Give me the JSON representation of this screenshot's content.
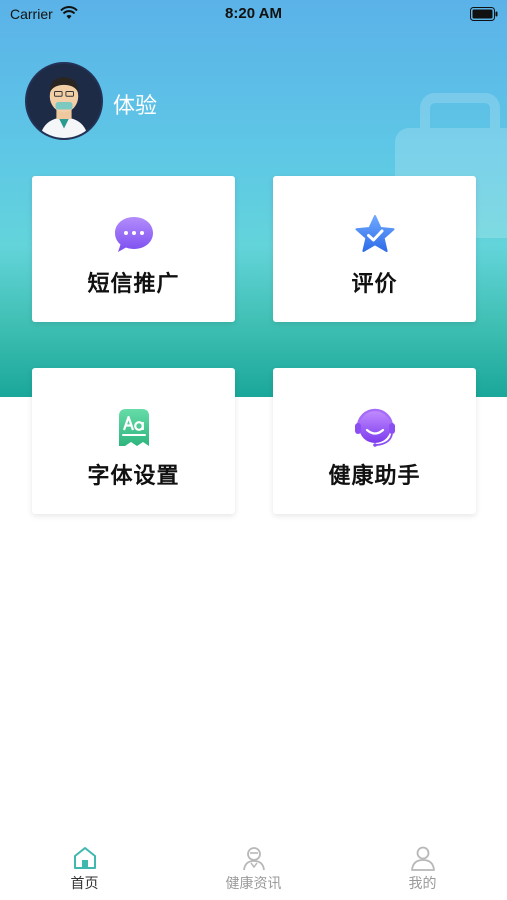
{
  "status_bar": {
    "carrier": "Carrier",
    "time": "8:20 AM"
  },
  "user": {
    "name": "体验"
  },
  "cards": [
    {
      "label": "短信推广",
      "icon": "chat-bubble-icon",
      "color": "#8b5cf6"
    },
    {
      "label": "评价",
      "icon": "star-badge-icon",
      "color": "#3b82f6"
    },
    {
      "label": "字体设置",
      "icon": "font-aa-icon",
      "color": "#34c38f"
    },
    {
      "label": "健康助手",
      "icon": "headset-icon",
      "color": "#9b59f5"
    }
  ],
  "tabbar": [
    {
      "label": "首页",
      "icon": "home-icon",
      "active": true
    },
    {
      "label": "健康资讯",
      "icon": "doctor-icon",
      "active": false
    },
    {
      "label": "我的",
      "icon": "person-icon",
      "active": false
    }
  ],
  "colors": {
    "hero_top": "#5bb2e8",
    "hero_bottom": "#1aa79a",
    "tab_active": "#3fb8b0"
  }
}
